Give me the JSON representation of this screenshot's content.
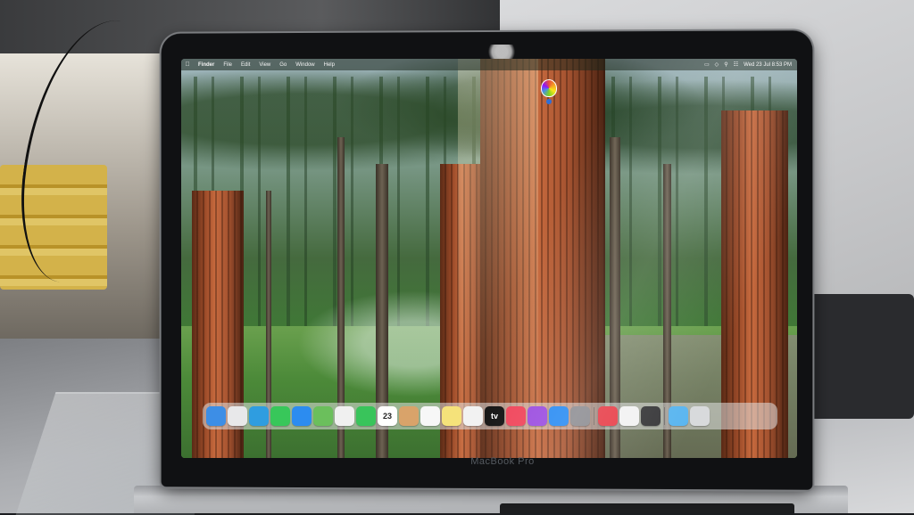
{
  "menubar": {
    "apple_icon": "apple-icon",
    "items": [
      "Finder",
      "File",
      "Edit",
      "View",
      "Go",
      "Window",
      "Help"
    ],
    "clock": "Wed 23 Jul 8:53 PM"
  },
  "dock": {
    "apps": [
      {
        "name": "finder",
        "icon": "finder-icon",
        "color": "#3d8ee6"
      },
      {
        "name": "launchpad",
        "icon": "launchpad-icon",
        "color": "#e8e8ea"
      },
      {
        "name": "safari",
        "icon": "safari-icon",
        "color": "#2f9de0"
      },
      {
        "name": "messages",
        "icon": "messages-icon",
        "color": "#38c75a"
      },
      {
        "name": "mail",
        "icon": "mail-icon",
        "color": "#2c8cf0"
      },
      {
        "name": "maps",
        "icon": "maps-icon",
        "color": "#6bbf5c"
      },
      {
        "name": "photos",
        "icon": "photos-icon",
        "color": "#f0f0f0"
      },
      {
        "name": "facetime",
        "icon": "facetime-icon",
        "color": "#39c45b"
      },
      {
        "name": "calendar",
        "icon": "calendar-icon",
        "color": "#ffffff",
        "label": "23"
      },
      {
        "name": "contacts",
        "icon": "contacts-icon",
        "color": "#d9a36a"
      },
      {
        "name": "reminders",
        "icon": "reminders-icon",
        "color": "#f7f7f7"
      },
      {
        "name": "notes",
        "icon": "notes-icon",
        "color": "#f5e27a"
      },
      {
        "name": "freeform",
        "icon": "freeform-icon",
        "color": "#f2f2f2"
      },
      {
        "name": "tv",
        "icon": "apple-tv-icon",
        "color": "#111111",
        "label": "tv"
      },
      {
        "name": "music",
        "icon": "music-icon",
        "color": "#f0445a"
      },
      {
        "name": "podcasts",
        "icon": "podcasts-icon",
        "color": "#9b4de0"
      },
      {
        "name": "app-store",
        "icon": "app-store-icon",
        "color": "#2a8cf3"
      },
      {
        "name": "system-settings",
        "icon": "gear-icon",
        "color": "#8e8e93"
      }
    ],
    "recents": [
      {
        "name": "news",
        "icon": "news-icon",
        "color": "#e8414c"
      },
      {
        "name": "preview",
        "icon": "preview-icon",
        "color": "#f2f2f2"
      },
      {
        "name": "quicktime",
        "icon": "quicktime-icon",
        "color": "#3a3a3c"
      }
    ],
    "trailing": [
      {
        "name": "downloads",
        "icon": "downloads-folder-icon",
        "color": "#5bb6f0"
      },
      {
        "name": "trash",
        "icon": "trash-icon",
        "color": "#d8dadc"
      }
    ]
  },
  "laptop": {
    "brand": "MacBook Pro"
  }
}
